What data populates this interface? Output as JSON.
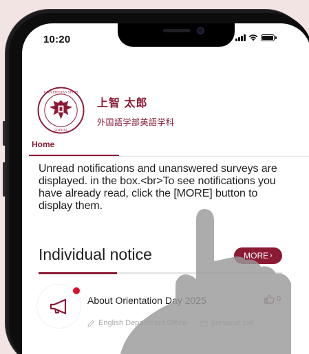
{
  "status_bar": {
    "time": "10:20"
  },
  "profile": {
    "name": "上智 太郎",
    "department": "外国語学部英語学科",
    "crest_icon": "university-crest-icon"
  },
  "tabs": {
    "home_label": "Home"
  },
  "intro": {
    "text": "Unread notifications and unanswered surveys are displayed. in the box.<br>To see notifications you have already read, click the [MORE] button to display them."
  },
  "section": {
    "title": "Individual notice",
    "more_label": "MORE"
  },
  "notice": {
    "title": "About Orientation Day 2025",
    "likes": "0",
    "office": "English Department Office",
    "type": "personal call",
    "icon": "megaphone-icon",
    "unread": true
  },
  "colors": {
    "brand": "#8b1a35",
    "unread_dot": "#d9102b",
    "background": "#f3e4e4"
  }
}
